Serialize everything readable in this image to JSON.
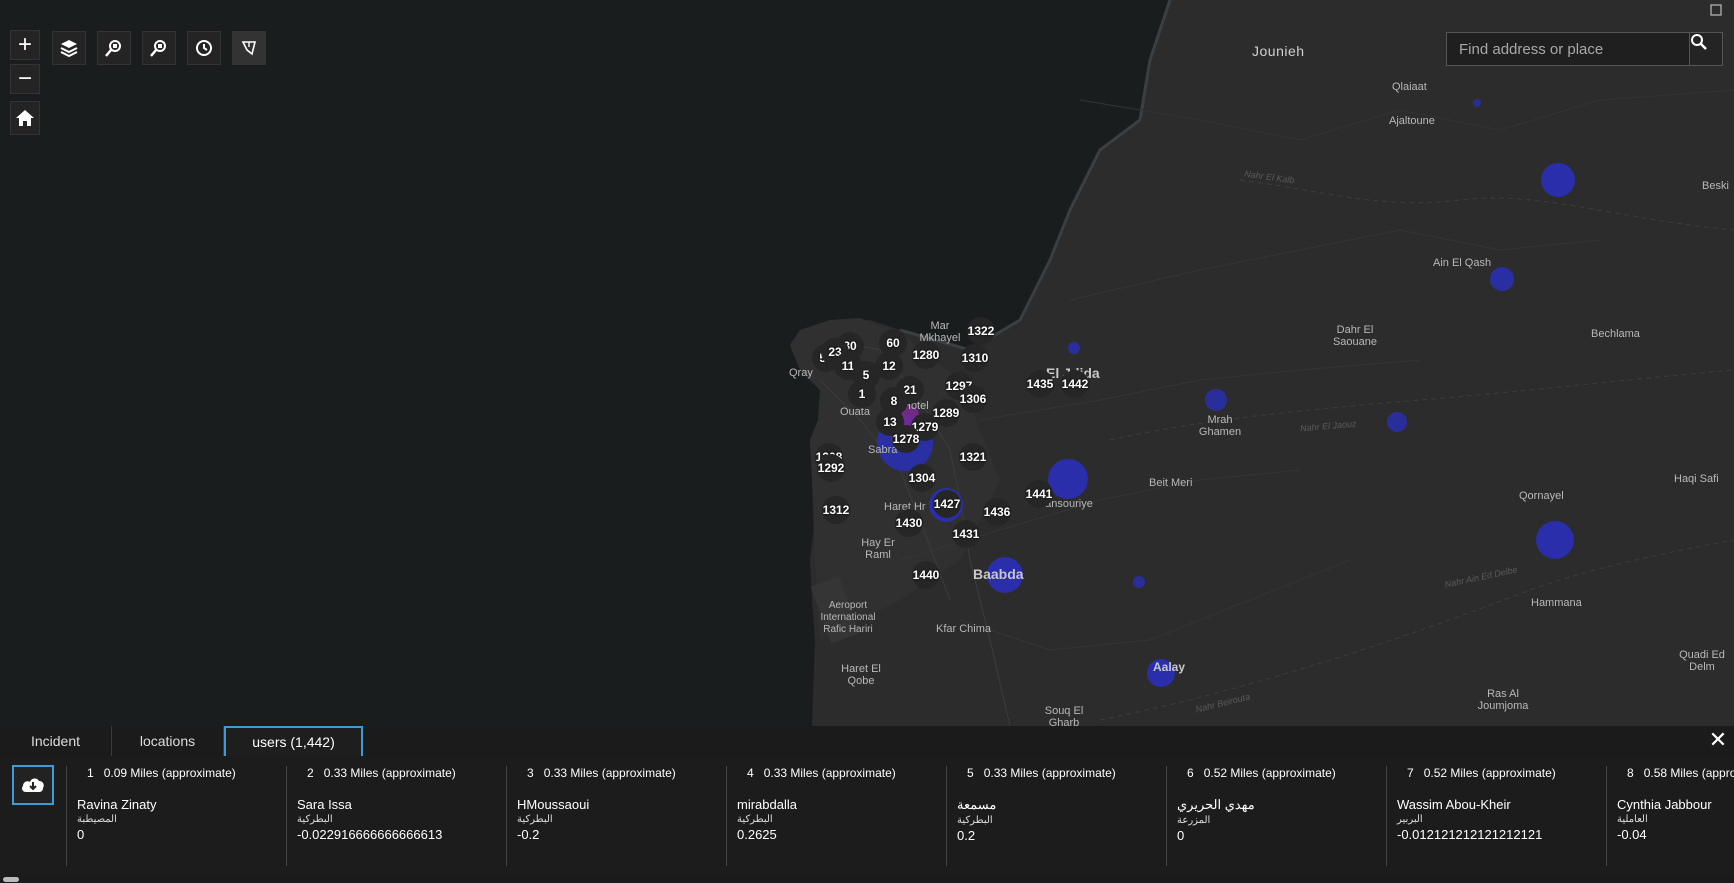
{
  "search": {
    "placeholder": "Find address or place"
  },
  "toolbar": {
    "zoom_in": "+",
    "zoom_out": "−"
  },
  "places": {
    "jounieh": "Jounieh",
    "qlaiaat": "Qlaiaat",
    "ajaltoune": "Ajaltoune",
    "beski": "Beski",
    "ain_el_qash": "Ain El Qash",
    "dahr_el_saouane": "Dahr El Saouane",
    "bechlama": "Bechlama",
    "mar_mkhayel": "Mar Mkhayel",
    "el_jdida": "El Jdida",
    "mrah_ghamen": "Mrah Ghamen",
    "beit_meri": "Beit Meri",
    "haqi_safi": "Haqi Safi",
    "qornayel": "Qornayel",
    "ouata": "Ouata",
    "qray": "Qray",
    "sabra": "Sabra",
    "haret_hr": "Haret Hr",
    "mansouriye": "Mansouriye",
    "hay_er_raml": "Hay Er Raml",
    "baabda": "Baabda",
    "hammana": "Hammana",
    "aeroport": "Aeroport International Rafic Hariri",
    "kfar_chima": "Kfar Chima",
    "haret_el_qobe": "Haret El Qobe",
    "aalay": "Aalay",
    "quadi_ed_delm": "Quadi Ed Delm",
    "ras_al_joumjoma": "Ras Al Joumjoma",
    "souq_el_gharb": "Souq El Gharb",
    "hotel": "Hotel",
    "river_nahr_el_kalb": "Nahr El Kalb",
    "river_nahr_ed_jaouz": "Nahr El Jaouz",
    "river_nahr_ain": "Nahr Ain Ed Delbe",
    "river_nahr_beirouta": "Nahr Beirouta"
  },
  "clusters": [
    {
      "label": "58"
    },
    {
      "label": "30"
    },
    {
      "label": "23"
    },
    {
      "label": "11"
    },
    {
      "label": "60"
    },
    {
      "label": "12"
    },
    {
      "label": "1280"
    },
    {
      "label": "1322"
    },
    {
      "label": "1310"
    },
    {
      "label": "5"
    },
    {
      "label": "1"
    },
    {
      "label": "21"
    },
    {
      "label": "8"
    },
    {
      "label": "1297"
    },
    {
      "label": "1306"
    },
    {
      "label": "1289"
    },
    {
      "label": "13"
    },
    {
      "label": "1279"
    },
    {
      "label": "1278"
    },
    {
      "label": "1435"
    },
    {
      "label": "1442"
    },
    {
      "label": "1308"
    },
    {
      "label": "1292"
    },
    {
      "label": "1321"
    },
    {
      "label": "1304"
    },
    {
      "label": "1427"
    },
    {
      "label": "1441"
    },
    {
      "label": "1312"
    },
    {
      "label": "1430"
    },
    {
      "label": "1436"
    },
    {
      "label": "1431"
    },
    {
      "label": "1440"
    }
  ],
  "tabs": [
    {
      "label": "Incident"
    },
    {
      "label": "locations"
    },
    {
      "label": "users (1,442)"
    }
  ],
  "close_label": "✕",
  "results": [
    {
      "n": "1",
      "distance": "0.09 Miles (approximate)",
      "name": "Ravina Zinaty",
      "area": "المصيطبة",
      "value": "0"
    },
    {
      "n": "2",
      "distance": "0.33 Miles (approximate)",
      "name": "Sara Issa",
      "area": "البطركية",
      "value": "-0.022916666666666613"
    },
    {
      "n": "3",
      "distance": "0.33 Miles (approximate)",
      "name": "HMoussaoui",
      "area": "البطركية",
      "value": "-0.2"
    },
    {
      "n": "4",
      "distance": "0.33 Miles (approximate)",
      "name": "mirabdalla",
      "area": "البطركية",
      "value": "0.2625"
    },
    {
      "n": "5",
      "distance": "0.33 Miles (approximate)",
      "name": "مسمعة",
      "area": "البطركية",
      "value": "0.2"
    },
    {
      "n": "6",
      "distance": "0.52 Miles (approximate)",
      "name": "مهدي الحريري",
      "area": "المزرعة",
      "value": "0"
    },
    {
      "n": "7",
      "distance": "0.52 Miles (approximate)",
      "name": "Wassim Abou-Kheir",
      "area": "البربير",
      "value": "-0.012121212121212121"
    },
    {
      "n": "8",
      "distance": "0.58 Miles (appro",
      "name": "Cynthia Jabbour",
      "area": "العاملية",
      "value": "-0.04"
    }
  ]
}
